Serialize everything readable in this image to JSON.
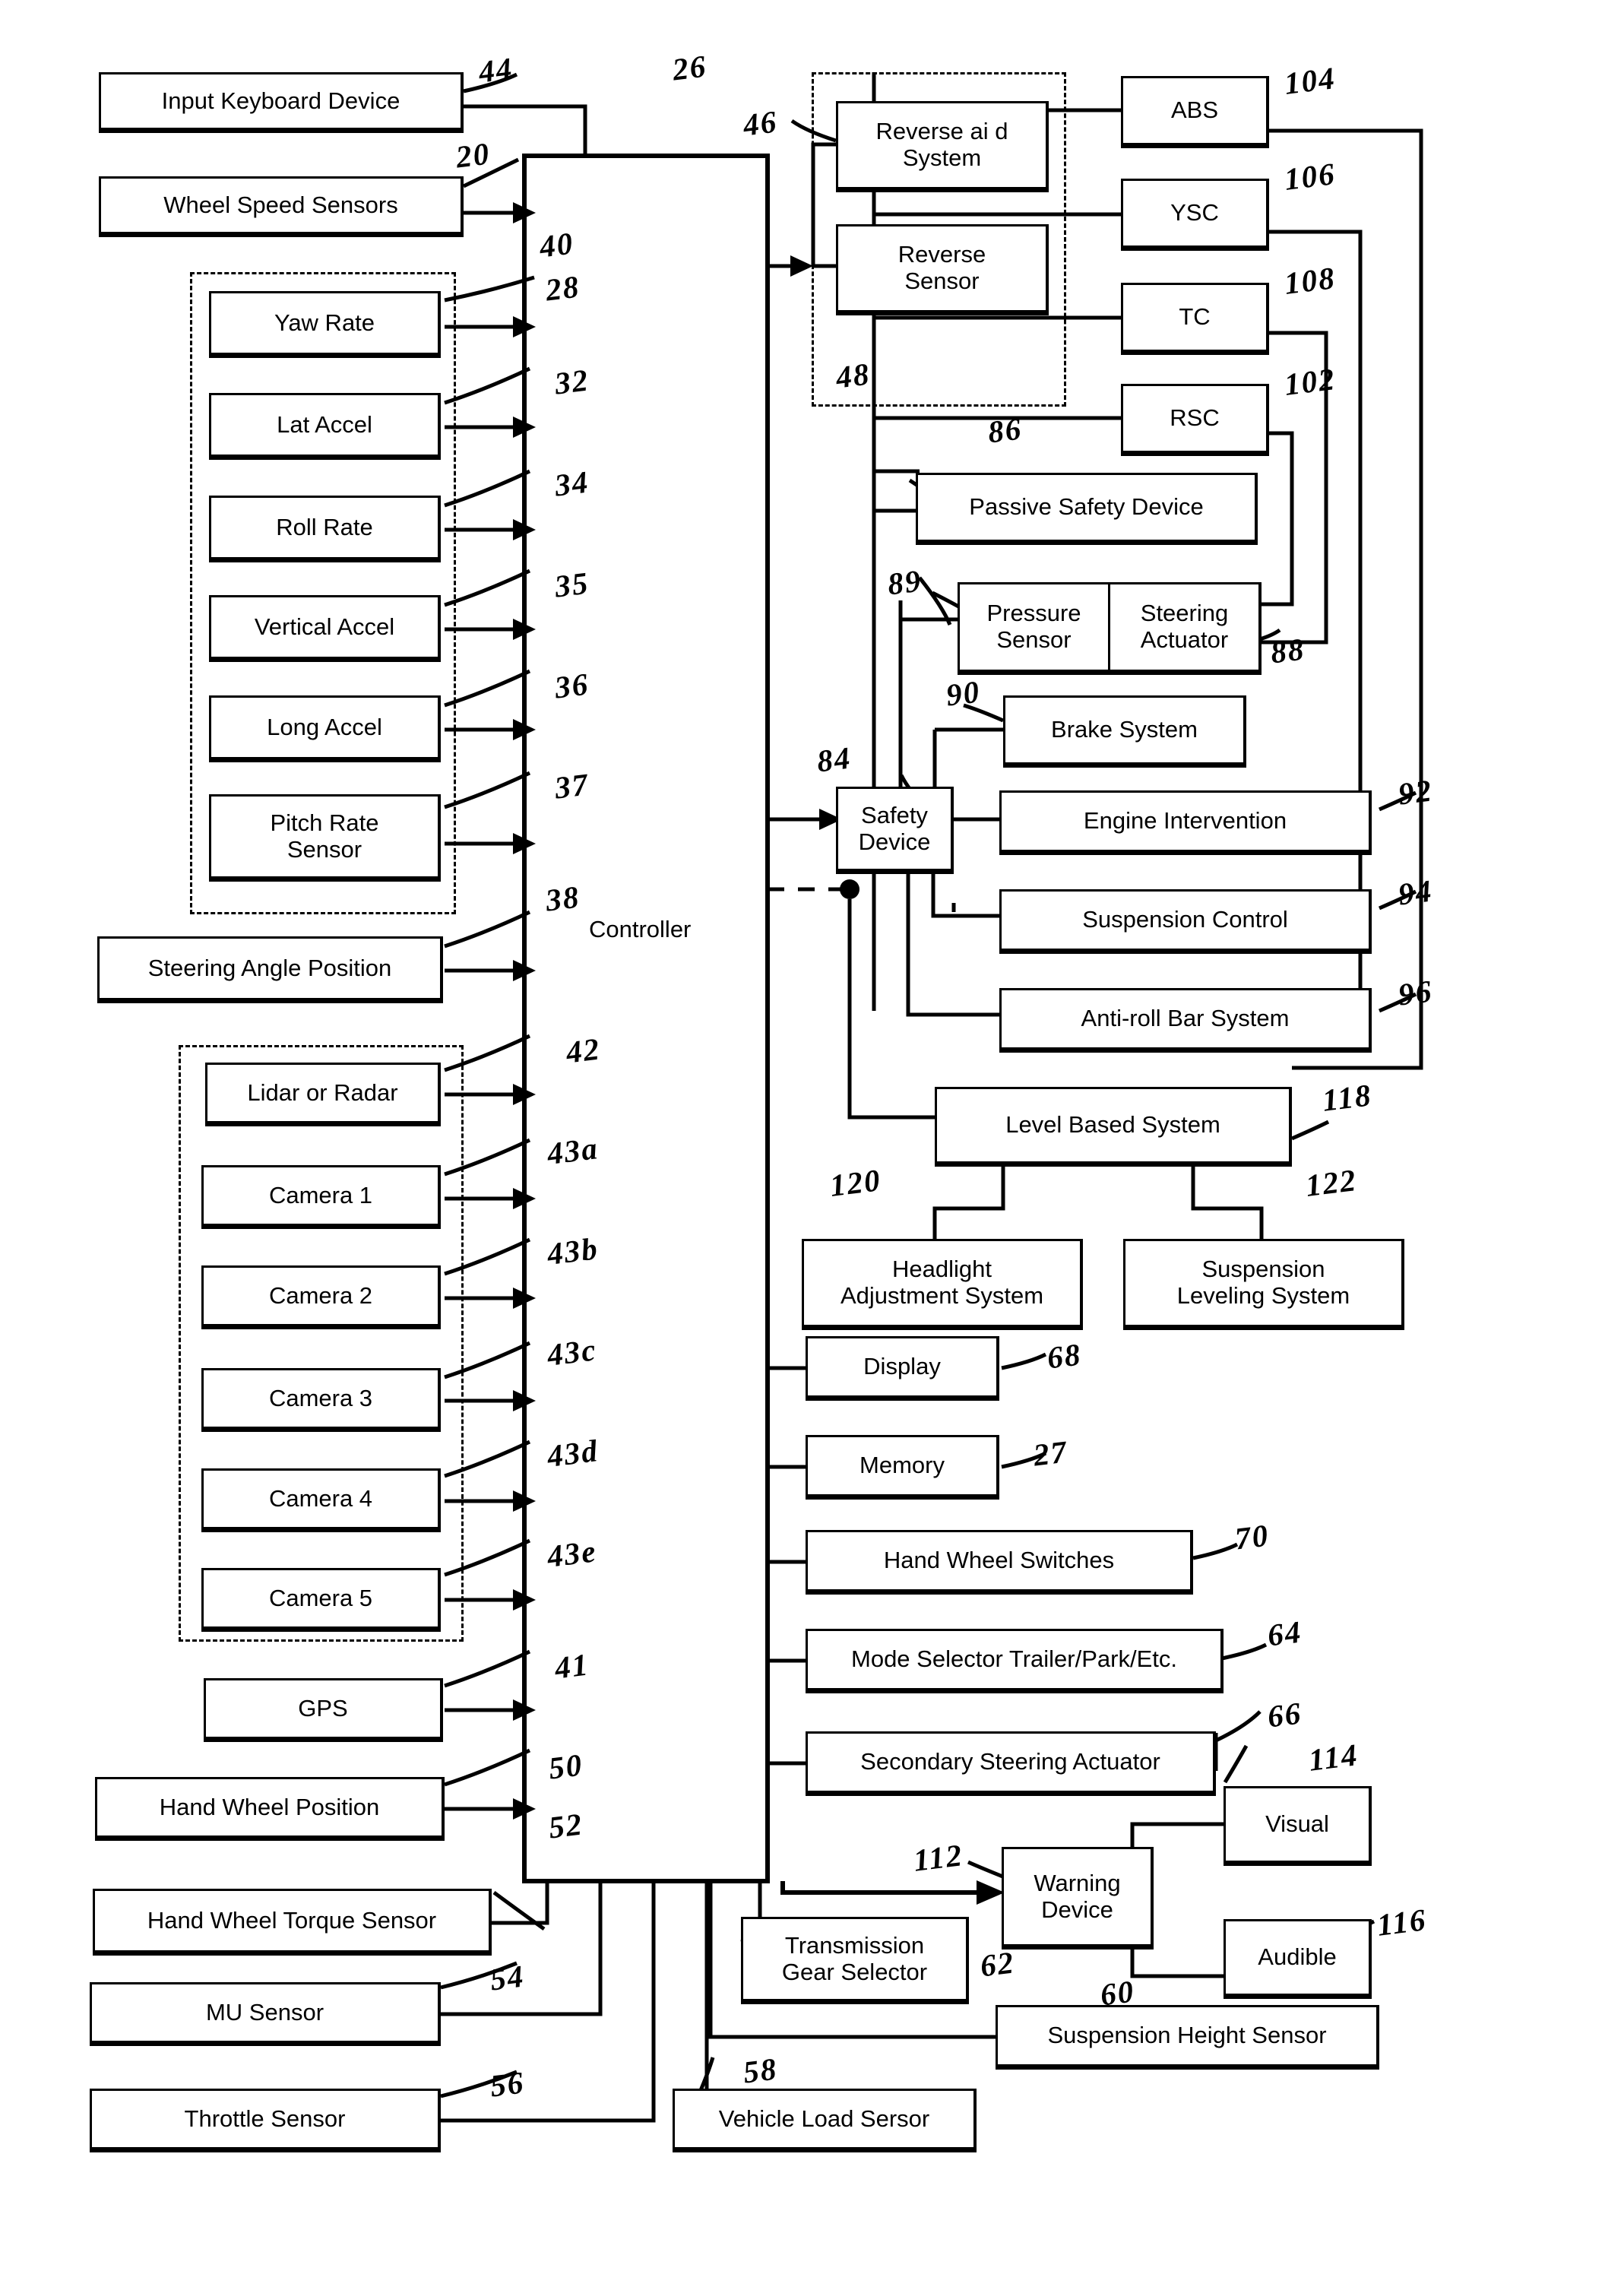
{
  "figure": {
    "controller_label": "Controller",
    "controller_ref": "20"
  },
  "boxes": {
    "input_keyboard_device": {
      "label": "Input Keyboard Device",
      "ref": "44"
    },
    "wheel_speed_sensors": {
      "label": "Wheel Speed Sensors",
      "ref": "20"
    },
    "yaw_rate": {
      "label": "Yaw Rate",
      "ref": "28"
    },
    "lat_accel": {
      "label": "Lat Accel",
      "ref": "32"
    },
    "roll_rate": {
      "label": "Roll Rate",
      "ref": "34"
    },
    "vertical_accel": {
      "label": "Vertical Accel",
      "ref": "35"
    },
    "long_accel": {
      "label": "Long Accel",
      "ref": "36"
    },
    "pitch_rate_sensor": {
      "label": "Pitch Rate\nSensor",
      "line1": "Pitch Rate",
      "line2": "Sensor",
      "ref": "37"
    },
    "sensor_cluster_ref": "40",
    "steering_angle_position": {
      "label": "Steering Angle Position",
      "ref": "38"
    },
    "lidar_or_radar": {
      "label": "Lidar or Radar",
      "ref": "42"
    },
    "camera_1": {
      "label": "Camera 1",
      "ref": "43a"
    },
    "camera_2": {
      "label": "Camera 2",
      "ref": "43b"
    },
    "camera_3": {
      "label": "Camera 3",
      "ref": "43c"
    },
    "camera_4": {
      "label": "Camera 4",
      "ref": "43d"
    },
    "camera_5": {
      "label": "Camera 5",
      "ref": "43e"
    },
    "gps": {
      "label": "GPS",
      "ref": "41"
    },
    "hand_wheel_position": {
      "label": "Hand Wheel Position",
      "ref": "50"
    },
    "hand_wheel_torque_sensor": {
      "label": "Hand  Wheel Torque Sensor",
      "ref": "52"
    },
    "mu_sensor": {
      "label": "MU Sensor",
      "ref": "54"
    },
    "throttle_sensor": {
      "label": "Throttle Sensor",
      "ref": "56"
    },
    "vehicle_load_sensor": {
      "label": "Vehicle Load Sersor",
      "ref": "58"
    },
    "transmission_gear_selector": {
      "line1": "Transmission",
      "line2": "Gear Selector",
      "ref": "62"
    },
    "reverse_aid_system": {
      "line1": "Reverse ai d",
      "line2": "System",
      "ref": "46"
    },
    "reverse_sensor": {
      "line1": "Reverse",
      "line2": "Sensor",
      "ref": "48"
    },
    "abs": {
      "label": "ABS",
      "ref": "104"
    },
    "ysc": {
      "label": "YSC",
      "ref": "106"
    },
    "tc": {
      "label": "TC",
      "ref": "108"
    },
    "rsc": {
      "label": "RSC",
      "ref": "102"
    },
    "passive_safety_device": {
      "label": "Passive Safety Device",
      "ref": "86"
    },
    "pressure_sensor": {
      "line1": "Pressure",
      "line2": "Sensor",
      "ref": "89"
    },
    "steering_actuator": {
      "line1": "Steering",
      "line2": "Actuator",
      "ref": "88"
    },
    "brake_system": {
      "label": "Brake System",
      "ref": "90"
    },
    "safety_device": {
      "line1": "Safety",
      "line2": "Device",
      "ref": "84"
    },
    "engine_intervention": {
      "label": "Engine Intervention",
      "ref": "92"
    },
    "suspension_control": {
      "label": "Suspension Control",
      "ref": "94"
    },
    "anti_roll_bar_system": {
      "label": "Anti-roll Bar System",
      "ref": "96"
    },
    "level_based_system": {
      "label": "Level Based System",
      "ref": "118"
    },
    "headlight_adjustment_system": {
      "line1": "Headlight",
      "line2": "Adjustment System",
      "ref": "120"
    },
    "suspension_leveling_system": {
      "line1": "Suspension",
      "line2": "Leveling System",
      "ref": "122"
    },
    "display": {
      "label": "Display",
      "ref": "68"
    },
    "memory": {
      "label": "Memory",
      "ref": "27"
    },
    "hand_wheel_switches": {
      "label": "Hand Wheel Switches",
      "ref": "70"
    },
    "mode_selector": {
      "label": "Mode Selector Trailer/Park/Etc.",
      "ref": "64"
    },
    "secondary_steering_actuator": {
      "label": "Secondary Steering Actuator",
      "ref": "66"
    },
    "warning_device": {
      "line1": "Warning",
      "line2": "Device",
      "ref": "112"
    },
    "visual": {
      "label": "Visual",
      "ref": "114"
    },
    "audible": {
      "label": "Audible",
      "ref": "116"
    },
    "suspension_height_sensor": {
      "label": "Suspension Height Sensor",
      "ref": "60"
    }
  },
  "system_ref": "26"
}
